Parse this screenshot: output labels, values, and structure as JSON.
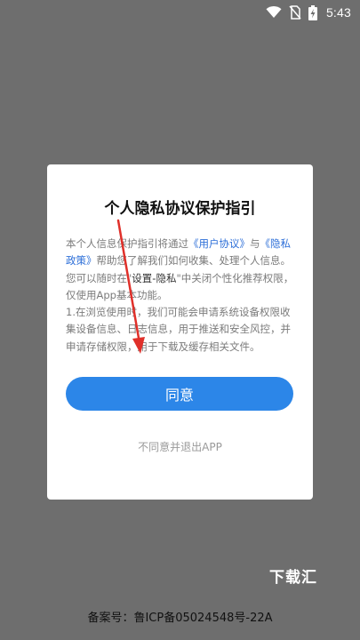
{
  "status_bar": {
    "time": "5:43",
    "icons": [
      "wifi-icon",
      "no-sim-icon",
      "battery-charging-icon"
    ]
  },
  "dialog": {
    "title": "个人隐私协议保护指引",
    "body": {
      "p1_a": "本个人信息保护指引将通过",
      "user_agreement": "《用户协议》",
      "p1_b": "与",
      "privacy_policy": "《隐私政策》",
      "p1_c": "帮助您了解我们如何收集、处理个人信息。您可以随时在\"",
      "settings_privacy": "设置-隐私",
      "p1_d": "\"中关闭个性化推荐权限，仅使用App基本功能。",
      "p2": "1.在浏览使用时，我们可能会申请系统设备权限收集设备信息、日志信息，用于推送和安全风控，并申请存储权限，用于下载及缓存相关文件。"
    },
    "agree_label": "同意",
    "decline_label": "不同意并退出APP"
  },
  "watermark": "下载汇",
  "footer": {
    "icp": "备案号：鲁ICP备05024548号-22A"
  },
  "colors": {
    "overlay": "#6e6e6e",
    "accent": "#2c86e8",
    "link": "#2d6fd8",
    "arrow": "#e0302a"
  }
}
